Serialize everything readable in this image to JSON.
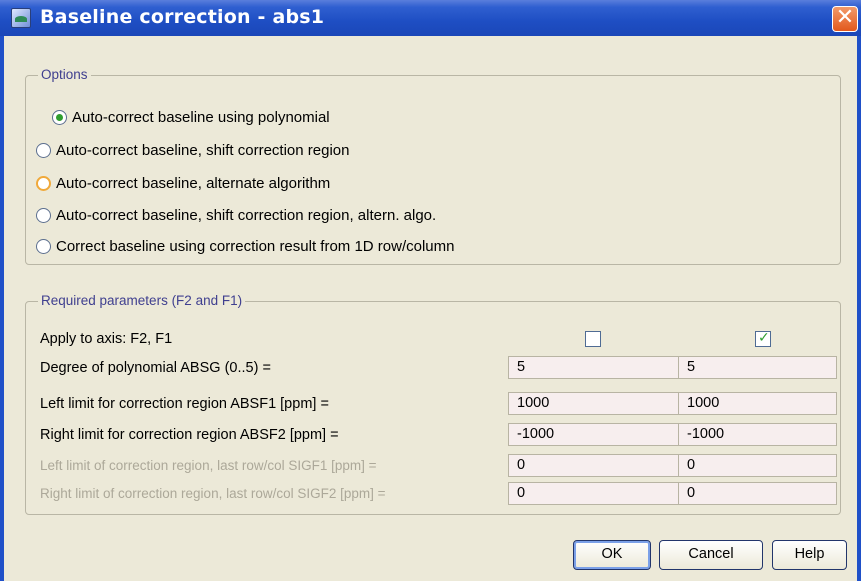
{
  "window": {
    "title": "Baseline correction - abs1",
    "close_glyph": "✕"
  },
  "options": {
    "legend": "Options",
    "items": [
      {
        "label": "Auto-correct baseline using polynomial",
        "checked": true
      },
      {
        "label": "Auto-correct baseline, shift correction region",
        "checked": false
      },
      {
        "label": "Auto-correct baseline, alternate algorithm",
        "checked": false,
        "hover": true
      },
      {
        "label": "Auto-correct baseline, shift correction region, altern. algo.",
        "checked": false
      },
      {
        "label": "Correct baseline using correction result from 1D row/column",
        "checked": false
      }
    ]
  },
  "params": {
    "legend": "Required parameters (F2 and F1)",
    "apply_label": "Apply to axis: F2, F1",
    "apply_f2": false,
    "apply_f1": true,
    "check_glyph": "✓",
    "rows": [
      {
        "label": "Degree of polynomial ABSG (0..5) =",
        "f2": "5",
        "f1": "5",
        "disabled": false
      },
      {
        "label": "Left limit for correction region ABSF1 [ppm] =",
        "f2": "1000",
        "f1": "1000",
        "disabled": false
      },
      {
        "label": "Right limit for correction region ABSF2 [ppm] =",
        "f2": "-1000",
        "f1": "-1000",
        "disabled": false
      },
      {
        "label": "Left limit of correction region, last row/col SIGF1 [ppm] =",
        "f2": "0",
        "f1": "0",
        "disabled": true
      },
      {
        "label": "Right limit of correction region, last row/col SIGF2 [ppm] =",
        "f2": "0",
        "f1": "0",
        "disabled": true
      }
    ]
  },
  "buttons": {
    "ok": "OK",
    "cancel": "Cancel",
    "help": "Help"
  },
  "colors": {
    "titlebar": "#1e4ec3",
    "dialog_bg": "#ece9d8",
    "field_bg": "#f7eeee",
    "check_green": "#2f9e2f"
  }
}
